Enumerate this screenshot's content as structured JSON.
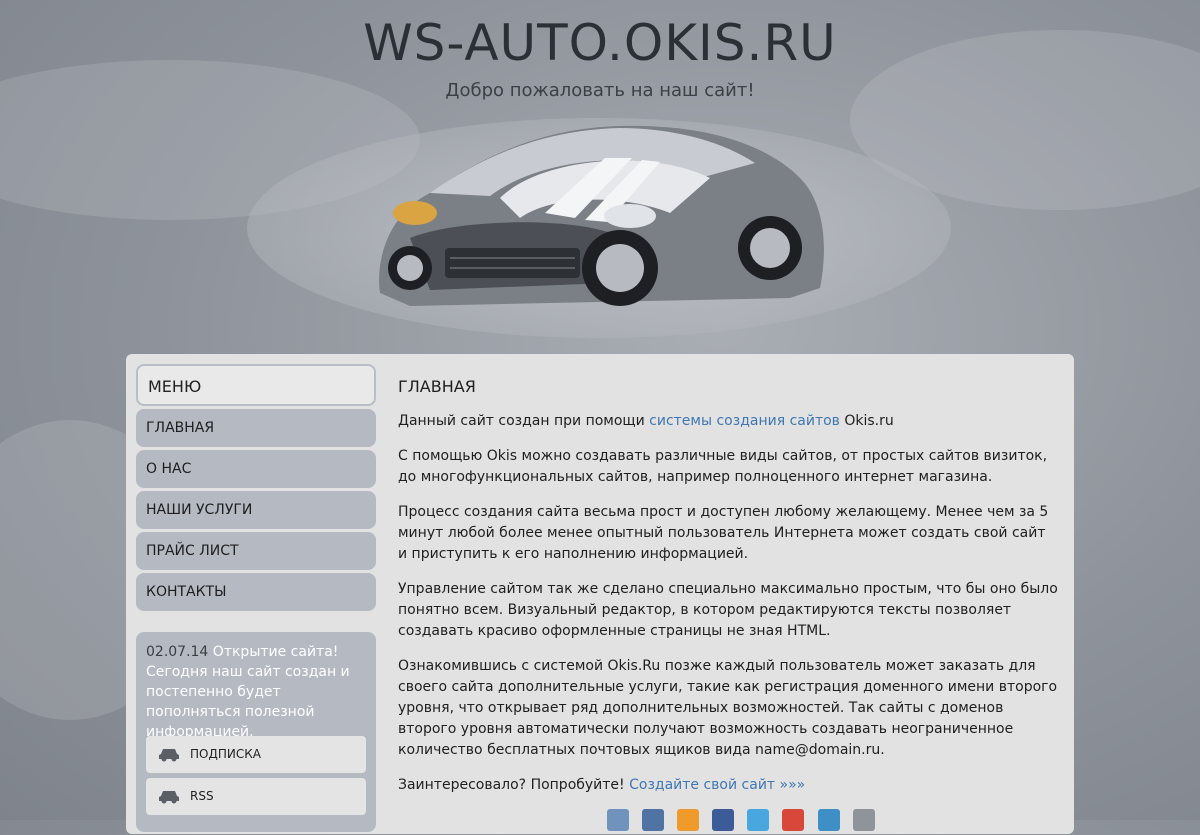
{
  "header": {
    "site_title": "WS-AUTO.OKIS.RU",
    "subtitle": "Добро пожаловать на наш сайт!"
  },
  "sidebar": {
    "menu_title": "МЕНЮ",
    "items": [
      {
        "label": "ГЛАВНАЯ"
      },
      {
        "label": "О НАС"
      },
      {
        "label": "НАШИ УСЛУГИ"
      },
      {
        "label": "ПРАЙС ЛИСТ"
      },
      {
        "label": "КОНТАКТЫ"
      }
    ],
    "news": {
      "date": "02.07.14",
      "text": "Открытие сайта! Сегодня наш сайт создан и постепенно будет пополняться полезной информацией."
    },
    "buttons": {
      "subscribe": "ПОДПИСКА",
      "rss": "RSS"
    }
  },
  "main": {
    "heading": "ГЛАВНАЯ",
    "p1_before": "Данный сайт создан при помощи",
    "p1_link": "системы создания сайтов",
    "p1_after": "Okis.ru",
    "p2": "С помощью Okis можно создавать различные виды сайтов, от простых сайтов визиток, до многофункциональных сайтов, например полноценного интернет магазина.",
    "p3": "Процесс создания сайта весьма прост и доступен любому желающему. Менее чем за 5 минут любой более менее опытный пользователь Интернета может создать свой сайт и приступить к его наполнению информацией.",
    "p4": "Управление сайтом так же сделано специально максимально простым, что бы оно было понятно всем. Визуальный редактор, в котором редактируются тексты позволяет создавать красиво оформленные страницы не зная HTML.",
    "p5": "Ознакомившись с системой Okis.Ru позже каждый пользователь может заказать для своего сайта дополнительные услуги, такие как регистрация доменного имени второго уровня, что открывает ряд дополнительных возможностей. Так сайты с доменов второго уровня автоматически получают возможность создавать неограниченное количество бесплатных почтовых ящиков вида name@domain.ru.",
    "p6_before": "Заинтересовало? Попробуйте!",
    "p6_link": "Создайте свой сайт »»»"
  },
  "share_icons": [
    "livejournal-icon",
    "vk-icon",
    "odnoklassniki-icon",
    "facebook-icon",
    "twitter-icon",
    "google-plus-icon",
    "mail-ru-icon",
    "home-icon"
  ],
  "colors": {
    "link": "#3f77b3",
    "menu_item_bg": "#b5bac2",
    "panel_bg": "#e2e2e2"
  }
}
